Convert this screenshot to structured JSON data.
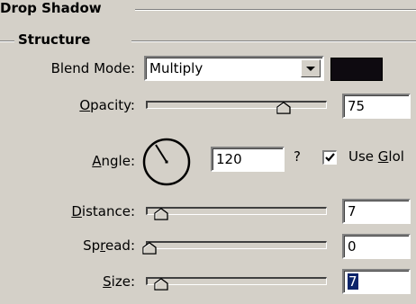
{
  "panel": {
    "title": "Drop Shadow",
    "group": "Structure"
  },
  "blend_mode": {
    "label_pre": "Blend Mode:",
    "value": "Multiply",
    "color": "#0e0a10"
  },
  "opacity": {
    "label_pre": "",
    "label_key": "O",
    "label_post": "pacity:",
    "value": "75",
    "fraction": 0.75
  },
  "angle": {
    "label_key": "A",
    "label_post": "ngle:",
    "value": "120",
    "unit": "?",
    "use_global_pre": "Use ",
    "use_global_key": "G",
    "use_global_post": "lol",
    "use_global_checked": true
  },
  "distance": {
    "label_key": "D",
    "label_post": "istance:",
    "value": "7"
  },
  "spread": {
    "label_pre": "Sp",
    "label_key": "r",
    "label_post": "ead:",
    "value": "0"
  },
  "size": {
    "label_key": "S",
    "label_post": "ize:",
    "value": "7"
  }
}
